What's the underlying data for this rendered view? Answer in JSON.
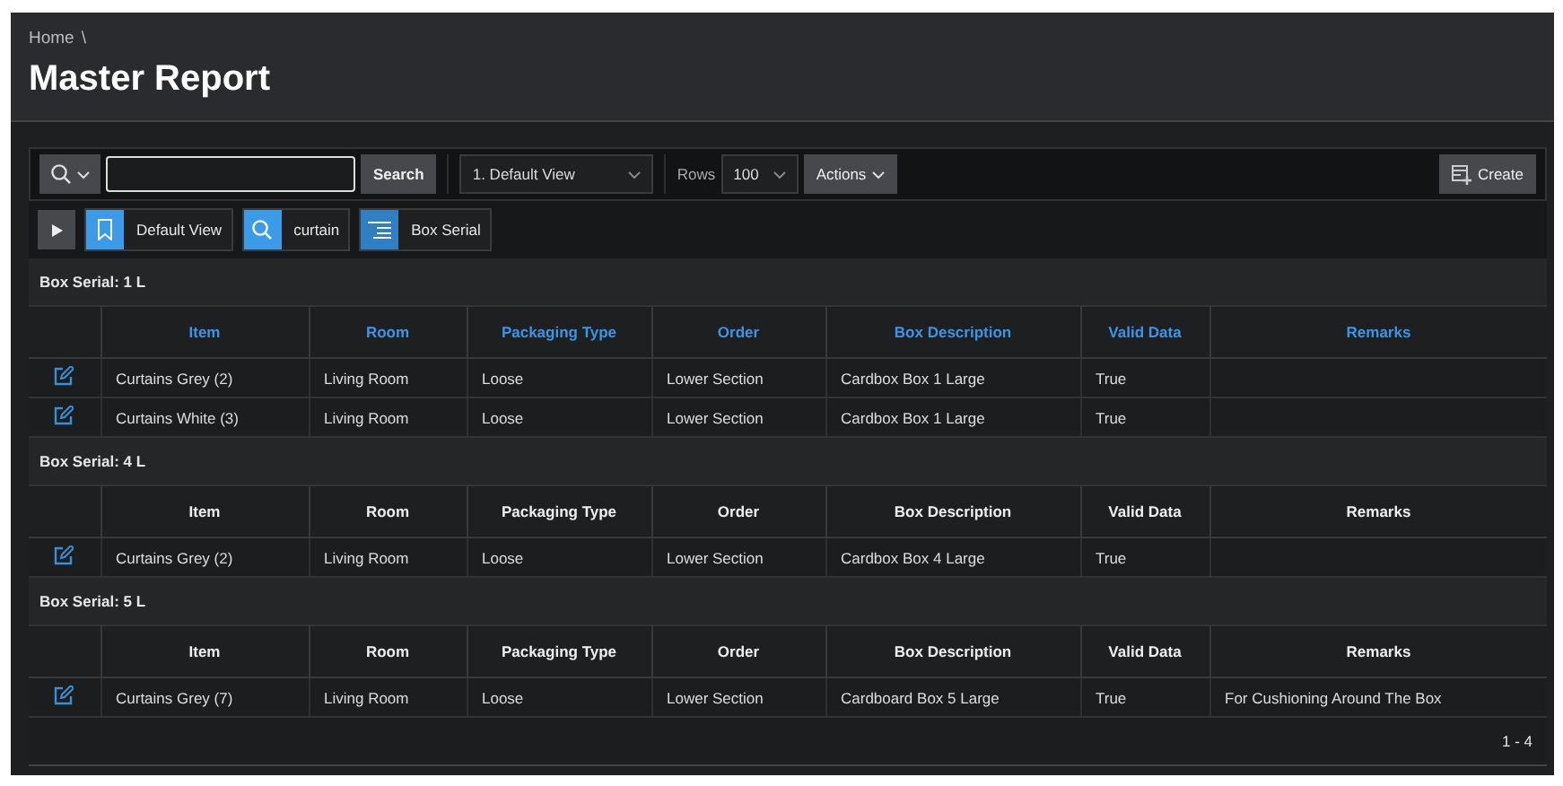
{
  "breadcrumb": {
    "items": [
      "Home"
    ],
    "separator": "\\"
  },
  "page_title": "Master Report",
  "toolbar": {
    "search_button": "Search",
    "report_select": "1. Default View",
    "rows_label": "Rows",
    "rows_select": "100",
    "actions_button": "Actions",
    "create_button": "Create"
  },
  "filters": [
    {
      "kind": "view",
      "label": "Default View"
    },
    {
      "kind": "search",
      "label": "curtain"
    },
    {
      "kind": "group",
      "label": "Box Serial"
    }
  ],
  "groups": [
    {
      "title": "Box Serial: 1 L",
      "highlighted": true,
      "columns": [
        "Item",
        "Room",
        "Packaging Type",
        "Order",
        "Box Description",
        "Valid Data",
        "Remarks"
      ],
      "rows": [
        [
          "Curtains Grey (2)",
          "Living Room",
          "Loose",
          "Lower Section",
          "Cardbox Box 1 Large",
          "True",
          ""
        ],
        [
          "Curtains White (3)",
          "Living Room",
          "Loose",
          "Lower Section",
          "Cardbox Box 1 Large",
          "True",
          ""
        ]
      ]
    },
    {
      "title": "Box Serial: 4 L",
      "highlighted": false,
      "columns": [
        "Item",
        "Room",
        "Packaging Type",
        "Order",
        "Box Description",
        "Valid Data",
        "Remarks"
      ],
      "rows": [
        [
          "Curtains Grey (2)",
          "Living Room",
          "Loose",
          "Lower Section",
          "Cardbox Box 4 Large",
          "True",
          ""
        ]
      ]
    },
    {
      "title": "Box Serial: 5 L",
      "highlighted": false,
      "columns": [
        "Item",
        "Room",
        "Packaging Type",
        "Order",
        "Box Description",
        "Valid Data",
        "Remarks"
      ],
      "rows": [
        [
          "Curtains Grey (7)",
          "Living Room",
          "Loose",
          "Lower Section",
          "Cardboard Box 5 Large",
          "True",
          "For Cushioning Around The Box"
        ]
      ]
    }
  ],
  "pagination": "1 - 4"
}
